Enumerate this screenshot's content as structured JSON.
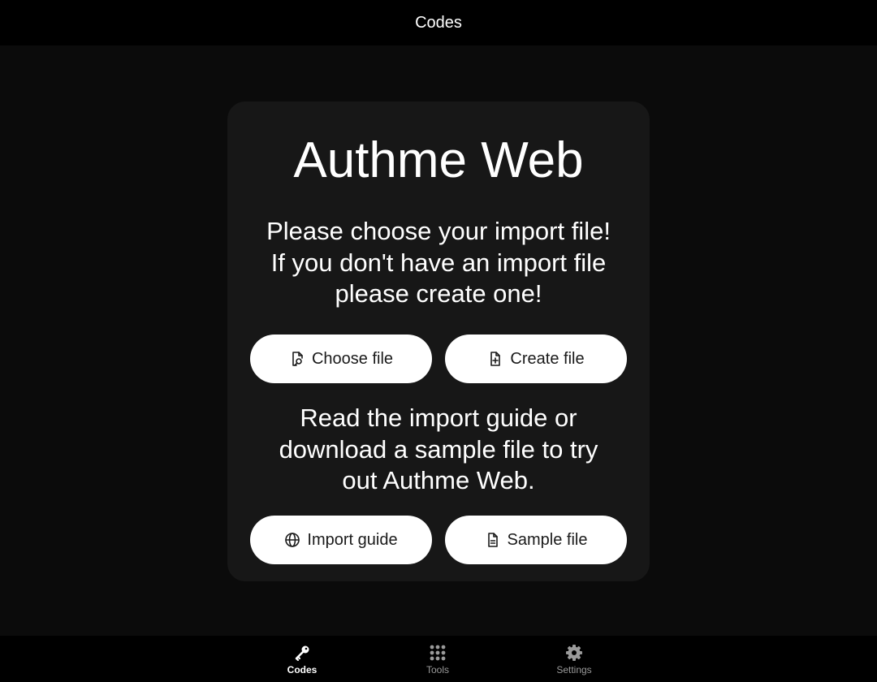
{
  "header": {
    "title": "Codes"
  },
  "card": {
    "title": "Authme Web",
    "intro_lines": [
      "Please choose your import file!",
      "If you don't have an import file",
      "please create one!"
    ],
    "buttons_top": {
      "choose": {
        "label": "Choose file",
        "icon": "file-search-icon"
      },
      "create": {
        "label": "Create file",
        "icon": "file-plus-icon"
      }
    },
    "guide_lines": [
      "Read the import guide or",
      "download a sample file to try",
      "out Authme Web."
    ],
    "buttons_bottom": {
      "guide": {
        "label": "Import guide",
        "icon": "globe-icon"
      },
      "sample": {
        "label": "Sample file",
        "icon": "file-text-icon"
      }
    }
  },
  "nav": {
    "items": [
      {
        "label": "Codes",
        "icon": "key-icon",
        "active": true
      },
      {
        "label": "Tools",
        "icon": "grid-icon",
        "active": false
      },
      {
        "label": "Settings",
        "icon": "gear-icon",
        "active": false
      }
    ]
  },
  "colors": {
    "background": "#0b0b0b",
    "header": "#000000",
    "card": "#171717",
    "button": "#ffffff",
    "nav_inactive": "#9a9a9a"
  }
}
